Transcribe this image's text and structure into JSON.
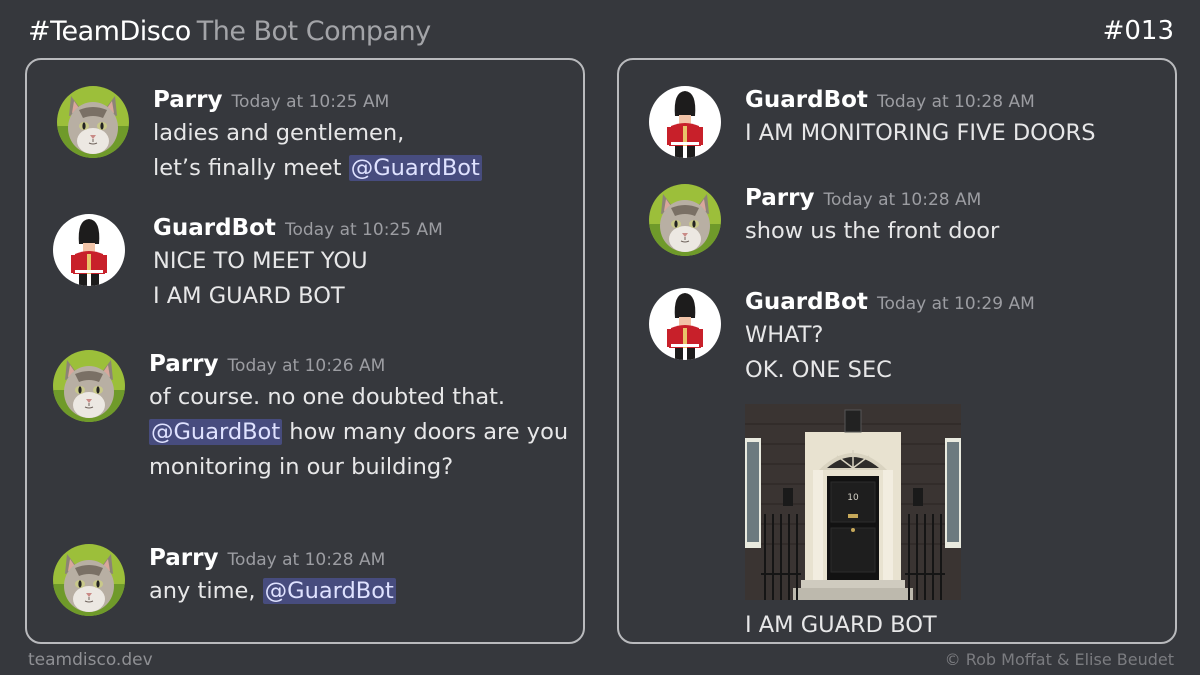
{
  "header": {
    "brand": "#TeamDisco",
    "subtitle": "The Bot Company",
    "episode": "#013"
  },
  "footer": {
    "site": "teamdisco.dev",
    "credit": "© Rob Moffat & Elise Beudet"
  },
  "icons": {
    "parry_avatar": "cat-avatar-icon",
    "guardbot_avatar": "royal-guard-avatar-icon",
    "door_image": "front-door-photo"
  },
  "colors": {
    "background": "#36383d",
    "mention_bg": "#474c7e",
    "timestamp": "#9c9da2"
  },
  "left_panel": {
    "messages": [
      {
        "author": "Parry",
        "time": "Today at 10:25 AM",
        "line1": "ladies and gentlemen,",
        "line2_prefix": "let’s finally meet ",
        "line2_mention": "@GuardBot"
      },
      {
        "author": "GuardBot",
        "time": "Today at 10:25 AM",
        "line1": "NICE TO MEET YOU",
        "line2": "I AM GUARD BOT"
      },
      {
        "author": "Parry",
        "time": "Today at 10:26 AM",
        "line1": "of course.  no one doubted that.",
        "line2_mention": "@GuardBot",
        "line2_suffix": " how many doors are you",
        "line3": "monitoring in our building?"
      },
      {
        "author": "Parry",
        "time": "Today at 10:28 AM",
        "line1_prefix": "any time, ",
        "line1_mention": "@GuardBot"
      }
    ]
  },
  "right_panel": {
    "messages": [
      {
        "author": "GuardBot",
        "time": "Today at 10:28 AM",
        "line1": "I AM MONITORING FIVE DOORS"
      },
      {
        "author": "Parry",
        "time": "Today at 10:28 AM",
        "line1": "show us the front door"
      },
      {
        "author": "GuardBot",
        "time": "Today at 10:29 AM",
        "line1": "WHAT?",
        "line2": "OK.   ONE SEC",
        "line3": "I AM GUARD BOT"
      }
    ]
  }
}
